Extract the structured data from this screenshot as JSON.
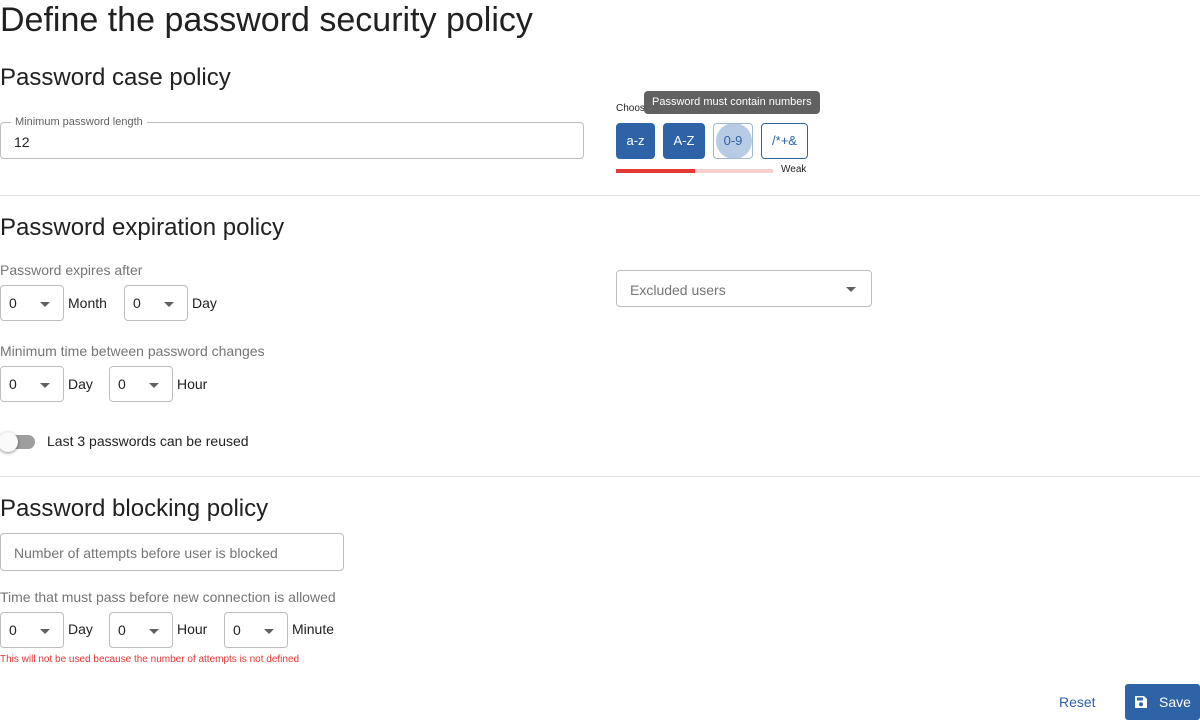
{
  "page_title": "Define the password security policy",
  "case_policy": {
    "heading": "Password case policy",
    "min_length_label": "Minimum password length",
    "min_length_value": "12",
    "choose_label": "Choose",
    "tooltip": "Password must contain numbers",
    "chips": [
      {
        "label": "a-z",
        "active": true
      },
      {
        "label": "A-Z",
        "active": true
      },
      {
        "label": "0-9",
        "active": false
      },
      {
        "label": "/*+&",
        "active": false
      }
    ],
    "strength_label": "Weak",
    "strength_level": 0.5,
    "strength_color": "#e53935"
  },
  "expiration_policy": {
    "heading": "Password expiration policy",
    "expires_label": "Password expires after",
    "expires_month_value": "0",
    "expires_month_unit": "Month",
    "expires_day_value": "0",
    "expires_day_unit": "Day",
    "min_time_label": "Minimum time between password changes",
    "min_day_value": "0",
    "min_day_unit": "Day",
    "min_hour_value": "0",
    "min_hour_unit": "Hour",
    "reuse_label": "Last 3 passwords can be reused",
    "reuse_enabled": false,
    "excluded_users_placeholder": "Excluded users"
  },
  "blocking_policy": {
    "heading": "Password blocking policy",
    "attempts_placeholder": "Number of attempts before user is blocked",
    "time_label": "Time that must pass before new connection is allowed",
    "day_value": "0",
    "day_unit": "Day",
    "hour_value": "0",
    "hour_unit": "Hour",
    "minute_value": "0",
    "minute_unit": "Minute",
    "warning": "This will not be used because the number of attempts is not defined"
  },
  "actions": {
    "reset_label": "Reset",
    "save_label": "Save"
  },
  "colors": {
    "primary": "#2e63a8",
    "error": "#e53935"
  }
}
